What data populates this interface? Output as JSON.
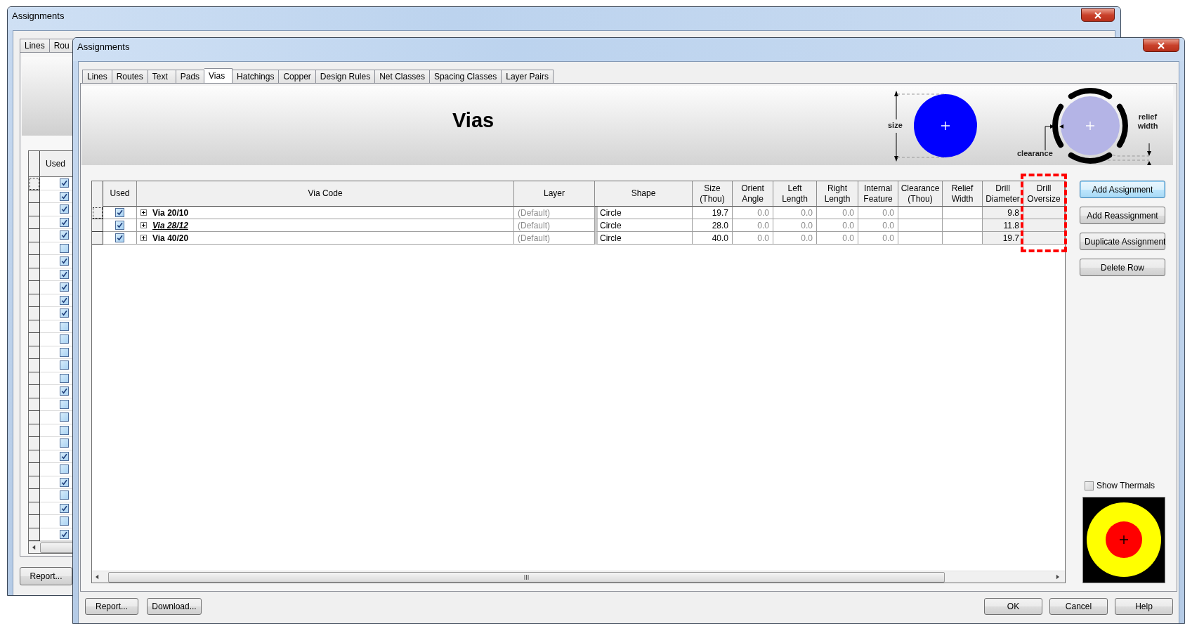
{
  "back_window": {
    "title": "Assignments",
    "tabs": [
      "Lines",
      "Rou"
    ],
    "grid": {
      "column": "Used",
      "rows": [
        {
          "used": true
        },
        {
          "used": true
        },
        {
          "used": true
        },
        {
          "used": true
        },
        {
          "used": true
        },
        {
          "used": false
        },
        {
          "used": true
        },
        {
          "used": true
        },
        {
          "used": true
        },
        {
          "used": true
        },
        {
          "used": true
        },
        {
          "used": false
        },
        {
          "used": false
        },
        {
          "used": false
        },
        {
          "used": false
        },
        {
          "used": false
        },
        {
          "used": true
        },
        {
          "used": false
        },
        {
          "used": false
        },
        {
          "used": false
        },
        {
          "used": false
        },
        {
          "used": true
        },
        {
          "used": false
        },
        {
          "used": true
        },
        {
          "used": false
        },
        {
          "used": true
        },
        {
          "used": false
        },
        {
          "used": true
        }
      ]
    },
    "buttons": [
      "Report..."
    ]
  },
  "window": {
    "title": "Assignments",
    "tabs": [
      {
        "label": "Lines",
        "selected": false
      },
      {
        "label": "Routes",
        "selected": false
      },
      {
        "label": "Text",
        "selected": false
      },
      {
        "label": "Pads",
        "selected": false
      },
      {
        "label": "Vias",
        "selected": true
      },
      {
        "label": "Hatchings",
        "selected": false
      },
      {
        "label": "Copper",
        "selected": false
      },
      {
        "label": "Design Rules",
        "selected": false
      },
      {
        "label": "Net Classes",
        "selected": false
      },
      {
        "label": "Spacing Classes",
        "selected": false
      },
      {
        "label": "Layer Pairs",
        "selected": false
      }
    ],
    "banner": {
      "title": "Vias",
      "size_label": "size",
      "clearance_label": "clearance",
      "relief_label": "relief width"
    },
    "table": {
      "columns": [
        "Used",
        "Via Code",
        "Layer",
        "Shape",
        "Size (Thou)",
        "Orient Angle",
        "Left Length",
        "Right Length",
        "Internal Feature",
        "Clearance (Thou)",
        "Relief Width",
        "Drill Diameter",
        "Drill Oversize"
      ],
      "rows": [
        {
          "selected": true,
          "used": true,
          "expanded": false,
          "code": "Via 20/10",
          "emphasized": false,
          "layer": "(Default)",
          "shape": "Circle",
          "size": "19.7",
          "orient_angle": "0.0",
          "left_length": "0.0",
          "right_length": "0.0",
          "internal_feature": "0.0",
          "drill_diameter": "9.8"
        },
        {
          "selected": false,
          "used": true,
          "expanded": false,
          "code": "Via 28/12",
          "emphasized": true,
          "layer": "(Default)",
          "shape": "Circle",
          "size": "28.0",
          "orient_angle": "0.0",
          "left_length": "0.0",
          "right_length": "0.0",
          "internal_feature": "0.0",
          "drill_diameter": "11.8"
        },
        {
          "selected": false,
          "used": true,
          "expanded": false,
          "code": "Via 40/20",
          "emphasized": false,
          "layer": "(Default)",
          "shape": "Circle",
          "size": "40.0",
          "orient_angle": "0.0",
          "left_length": "0.0",
          "right_length": "0.0",
          "internal_feature": "0.0",
          "drill_diameter": "19.7"
        }
      ]
    },
    "side_buttons": [
      {
        "label": "Add Assignment",
        "default": true
      },
      {
        "label": "Add Reassignment",
        "default": false
      },
      {
        "label": "Duplicate Assignment",
        "default": false
      },
      {
        "label": "Delete Row",
        "default": false
      }
    ],
    "show_thermals": {
      "label": "Show Thermals",
      "checked": false
    },
    "footer_left": [
      "Report...",
      "Download..."
    ],
    "footer_right": [
      "OK",
      "Cancel",
      "Help"
    ]
  }
}
